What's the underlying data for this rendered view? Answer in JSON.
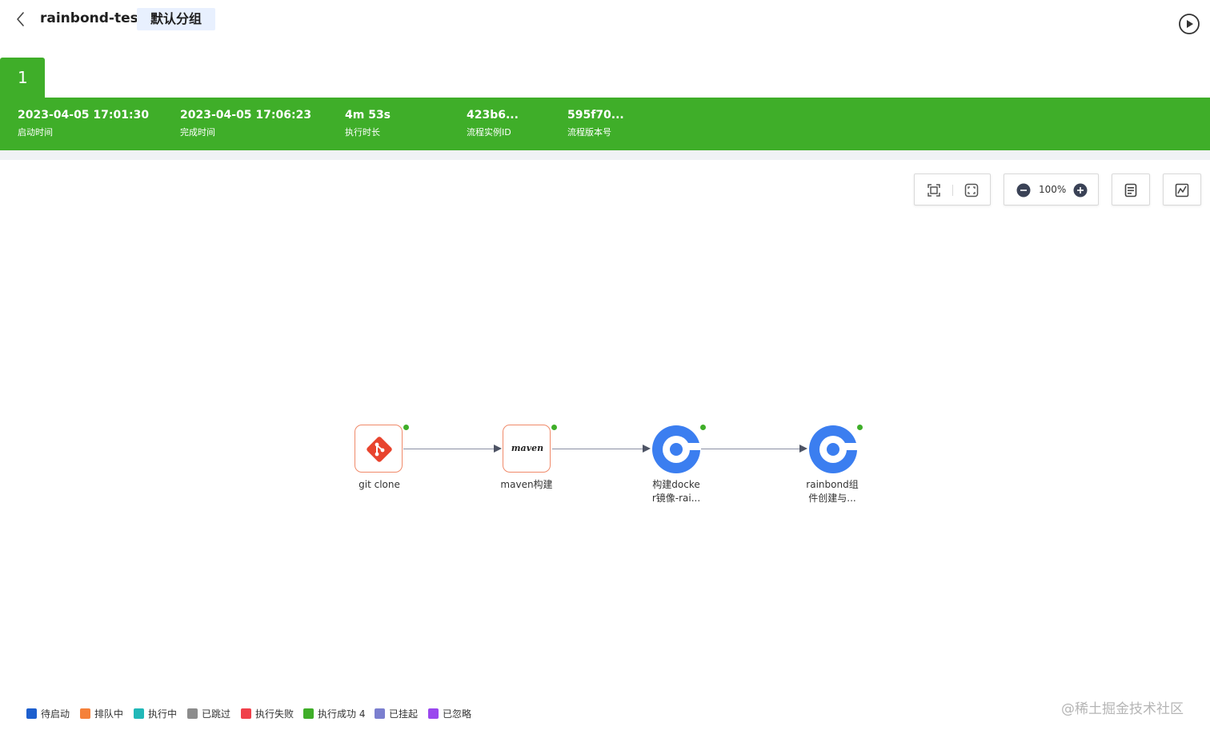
{
  "header": {
    "app_name": "rainbond-test",
    "group_name": "默认分组"
  },
  "build": {
    "number": "1",
    "start_time": "2023-04-05 17:01:30",
    "start_label": "启动时间",
    "end_time": "2023-04-05 17:06:23",
    "end_label": "完成时间",
    "duration": "4m 53s",
    "duration_label": "执行时长",
    "instance_id": "423b6...",
    "instance_label": "流程实例ID",
    "version": "595f70...",
    "version_label": "流程版本号",
    "status_color": "#3fae29"
  },
  "toolbar": {
    "zoom": "100%",
    "icons": [
      "fit-view-icon",
      "center-view-icon",
      "zoom-out-icon",
      "zoom-in-icon",
      "log-icon",
      "chart-icon"
    ]
  },
  "pipeline": {
    "nodes": [
      {
        "label": "git clone",
        "icon": "git-icon",
        "status": "success"
      },
      {
        "label": "maven构建",
        "icon": "maven-icon",
        "icon_text": "maven",
        "status": "success"
      },
      {
        "label": "构建docke\nr镜像-rai...",
        "icon": "rainbond-icon",
        "status": "success"
      },
      {
        "label": "rainbond组\n件创建与...",
        "icon": "rainbond-icon",
        "status": "success"
      }
    ]
  },
  "legend": {
    "items": [
      {
        "label": "待启动",
        "color": "#1d5fce"
      },
      {
        "label": "排队中",
        "color": "#f5813a"
      },
      {
        "label": "执行中",
        "color": "#21b8b8"
      },
      {
        "label": "已跳过",
        "color": "#8c8c8c"
      },
      {
        "label": "执行失败",
        "color": "#f0404a"
      },
      {
        "label": "执行成功 4",
        "color": "#3fae29"
      },
      {
        "label": "已挂起",
        "color": "#7b7fcf"
      },
      {
        "label": "已忽略",
        "color": "#9a48ee"
      }
    ]
  },
  "watermark": "@稀土掘金技术社区"
}
